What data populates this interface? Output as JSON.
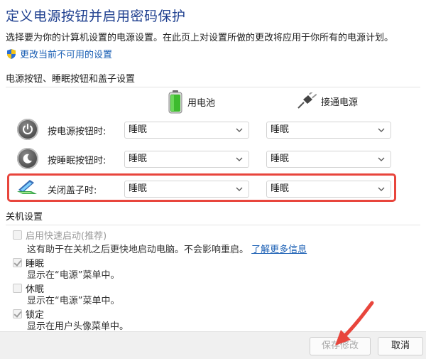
{
  "header": {
    "title": "定义电源按钮并启用密码保护",
    "description": "选择要为你的计算机设置的电源设置。在此页上对设置所做的更改将应用于你所有的电源计划。",
    "admin_link": "更改当前不可用的设置",
    "admin_icon": "uac-shield-icon"
  },
  "power_section": {
    "heading": "电源按钮、睡眠按钮和盖子设置",
    "columns": [
      {
        "label": "用电池",
        "icon": "battery-icon"
      },
      {
        "label": "接通电源",
        "icon": "power-plug-icon"
      }
    ],
    "rows": [
      {
        "label": "按电源按钮时:",
        "icon": "power-button-icon",
        "battery": "睡眠",
        "plugged": "睡眠"
      },
      {
        "label": "按睡眠按钮时:",
        "icon": "sleep-button-icon",
        "battery": "睡眠",
        "plugged": "睡眠"
      },
      {
        "label": "关闭盖子时:",
        "icon": "laptop-lid-icon",
        "battery": "睡眠",
        "plugged": "睡眠"
      }
    ],
    "highlight_color": "#e8453c"
  },
  "shutdown_section": {
    "heading": "关机设置",
    "items": [
      {
        "label": "启用快速启动(推荐)",
        "checked": false,
        "disabled": true,
        "desc": "这有助于在关机之后更快地启动电脑。不会影响重启。",
        "link": "了解更多信息"
      },
      {
        "label": "睡眠",
        "checked": true,
        "disabled": false,
        "desc": "显示在“电源”菜单中。"
      },
      {
        "label": "休眠",
        "checked": false,
        "disabled": false,
        "desc": "显示在“电源”菜单中。"
      },
      {
        "label": "锁定",
        "checked": true,
        "disabled": false,
        "desc": "显示在用户头像菜单中。"
      }
    ]
  },
  "footer": {
    "save_label": "保存修改",
    "cancel_label": "取消"
  },
  "colors": {
    "title": "#1e3f8f",
    "link": "#1a5fb4",
    "annotation_arrow": "#e8453c"
  }
}
